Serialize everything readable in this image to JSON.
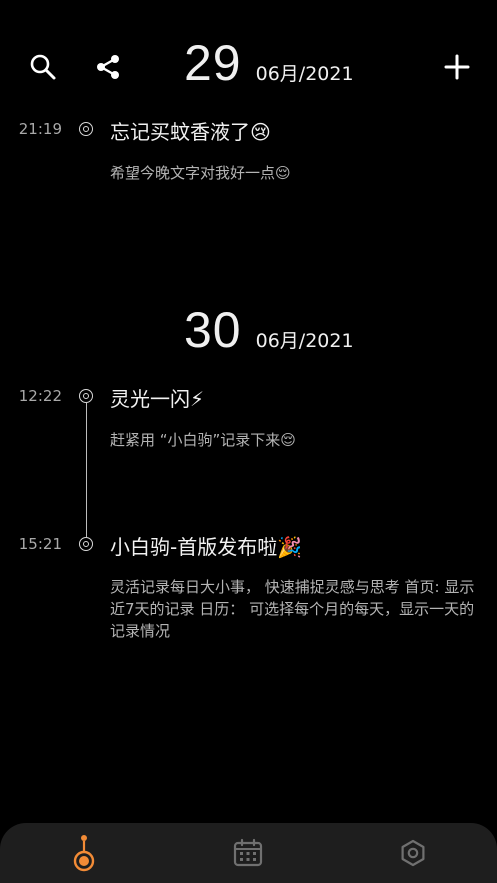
{
  "header": {
    "search_icon": "search-icon",
    "share_icon": "share-icon",
    "add_icon": "plus-icon"
  },
  "days": [
    {
      "day": "29",
      "date": "06月/2021",
      "entries": [
        {
          "time": "21:19",
          "title": "忘记买蚊香液了😢",
          "body": "希望今晚文字对我好一点😌"
        }
      ]
    },
    {
      "day": "30",
      "date": "06月/2021",
      "entries": [
        {
          "time": "12:22",
          "title": "灵光一闪⚡",
          "body": "赶紧用 “小白驹”记录下来😌"
        },
        {
          "time": "15:21",
          "title": "小白驹-首版发布啦🎉",
          "body": "灵活记录每日大小事， 快速捕捉灵感与思考 首页: 显示近7天的记录 日历： 可选择每个月的每天，显示一天的记录情况"
        }
      ]
    }
  ],
  "tabs": [
    {
      "icon": "timeline-icon",
      "active": true
    },
    {
      "icon": "calendar-icon",
      "active": false
    },
    {
      "icon": "settings-icon",
      "active": false
    }
  ],
  "colors": {
    "accent": "#F28B36",
    "background": "#000000",
    "tabbar": "#1E1E1E"
  }
}
